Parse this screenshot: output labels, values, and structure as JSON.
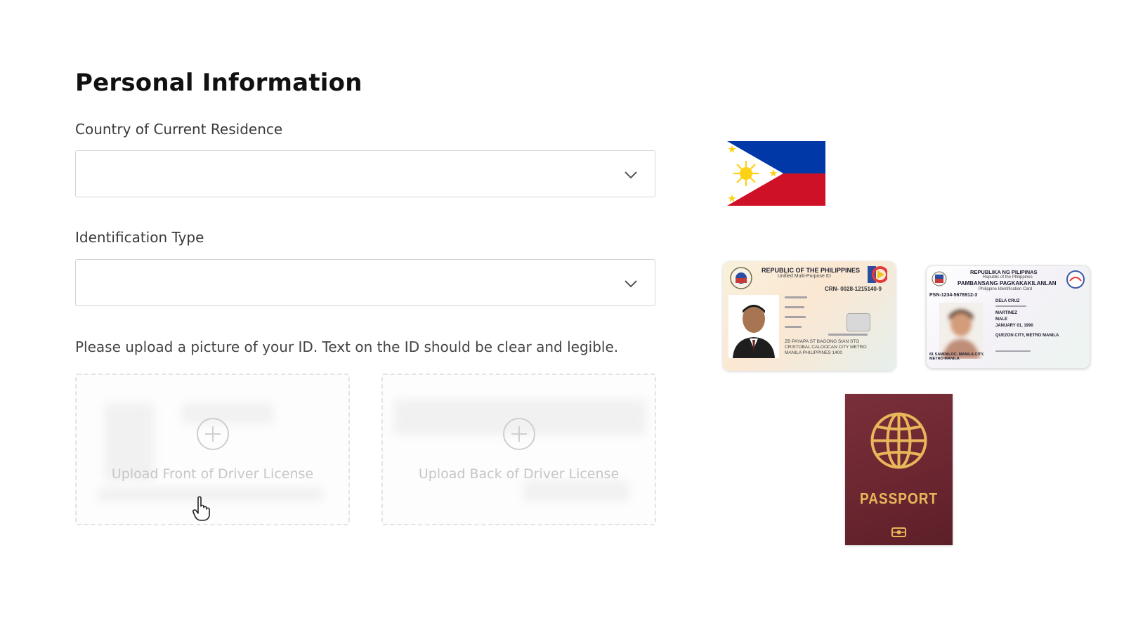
{
  "page": {
    "title": "Personal Information"
  },
  "country": {
    "label": "Country of Current Residence",
    "value": ""
  },
  "id_type": {
    "label": "Identification Type",
    "value": ""
  },
  "upload": {
    "hint": "Please upload a picture of your ID. Text on the ID should be clear and legible.",
    "front_label": "Upload Front of Driver License",
    "back_label": "Upload Back of Driver License"
  },
  "umid": {
    "header": "REPUBLIC OF THE PHILIPPINES",
    "subheader": "Unified Multi-Purpose ID",
    "crn": "CRN- 0028-1215140-9",
    "address": "ZB PAYAPA ST BAGONG SIAN STO CRISTOBAL CALOOCAN CITY METRO MANILA PHILIPPINES 1400"
  },
  "philid": {
    "header": "REPUBLIKA NG PILIPINAS",
    "subheader": "Republic of the Philippines",
    "title": "PAMBANSANG PAGKAKAKILANLAN",
    "subtitle": "Philippine Identification Card",
    "psn": "PSN-1234-5678912-3",
    "last_name": "DELA CRUZ",
    "middle_name": "MARTINEZ",
    "sex": "MALE",
    "dob": "JANUARY 01, 1990",
    "pob": "QUEZON CITY, METRO MANILA",
    "address": "81 SAMPALOC, MANILA CITY, METRO MANILA"
  },
  "passport": {
    "label": "PASSPORT"
  },
  "colors": {
    "flag_blue": "#0038a8",
    "flag_red": "#ce1126",
    "flag_yellow": "#fcd116",
    "passport": "#6a2630",
    "passport_gold": "#e7b75a"
  }
}
